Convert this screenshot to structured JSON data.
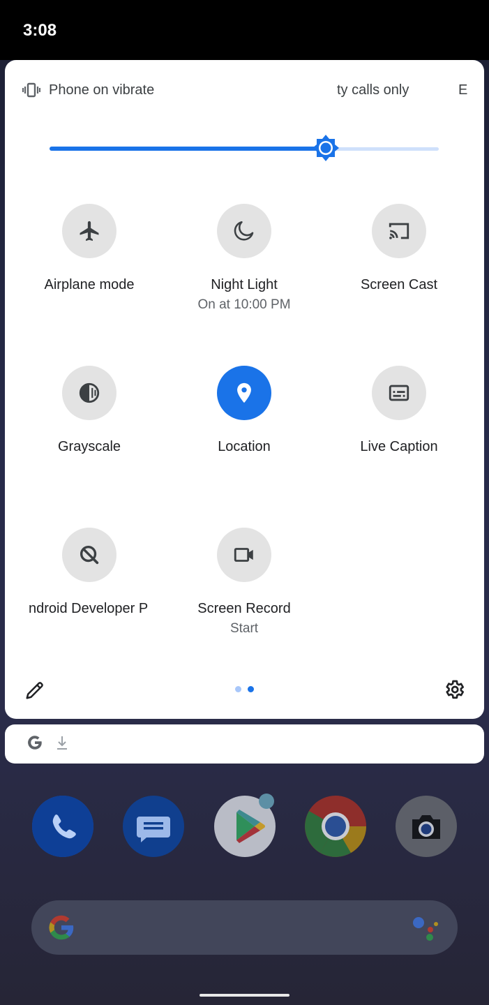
{
  "status_bar": {
    "time": "3:08"
  },
  "quick_settings": {
    "header": {
      "vibrate_text": "Phone on vibrate",
      "dnd_text": "ty calls only",
      "extra_text": "E"
    },
    "brightness_level": 0.71,
    "colors": {
      "accent": "#1a73e8",
      "tile_inactive": "#e3e3e3",
      "track_light": "#cfe0fb"
    },
    "tiles": [
      {
        "label": "Airplane mode",
        "sub": "",
        "icon": "airplane-icon",
        "active": false
      },
      {
        "label": "Night Light",
        "sub": "On at 10:00 PM",
        "icon": "moon-icon",
        "active": false
      },
      {
        "label": "Screen Cast",
        "sub": "",
        "icon": "cast-icon",
        "active": false
      },
      {
        "label": "Grayscale",
        "sub": "",
        "icon": "grayscale-icon",
        "active": false
      },
      {
        "label": "Location",
        "sub": "",
        "icon": "location-pin-icon",
        "active": true
      },
      {
        "label": "Live Caption",
        "sub": "",
        "icon": "caption-icon",
        "active": false
      },
      {
        "label": "ndroid Developer P",
        "sub": "",
        "icon": "developer-preview-icon",
        "active": false
      },
      {
        "label": "Screen Record",
        "sub": "Start",
        "icon": "video-camera-icon",
        "active": false
      }
    ],
    "footer": {
      "edit_icon": "pencil-icon",
      "settings_icon": "gear-icon",
      "page_count": 2,
      "current_page": 2
    }
  },
  "notification": {
    "app_icon": "google-g-icon",
    "status_icon": "download-icon"
  },
  "home": {
    "dock_apps": [
      "phone-icon",
      "messages-icon",
      "play-store-icon",
      "chrome-icon",
      "camera-icon"
    ],
    "search_bar": {
      "logo": "google-g-icon",
      "assistant": "assistant-icon"
    }
  }
}
